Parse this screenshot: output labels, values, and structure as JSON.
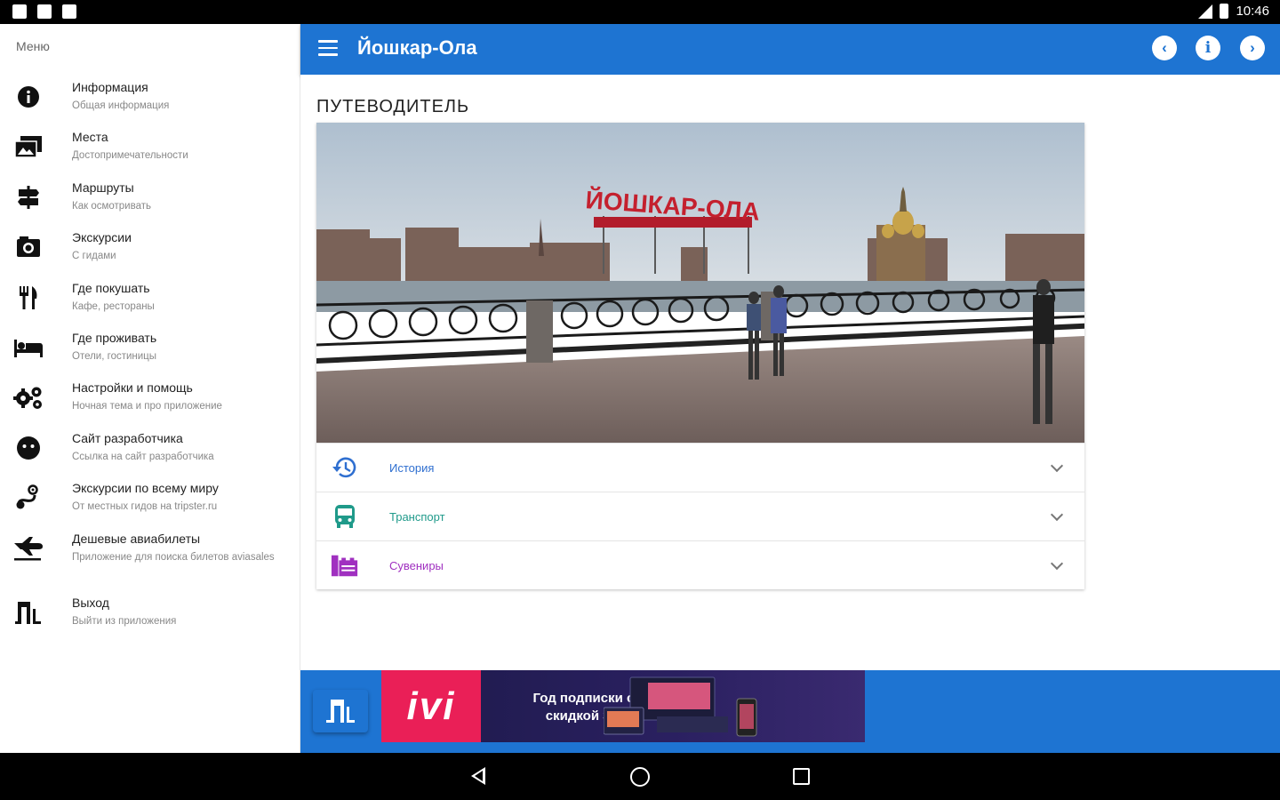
{
  "status_bar": {
    "time": "10:46"
  },
  "drawer": {
    "title": "Меню",
    "items": [
      {
        "title": "Информация",
        "subtitle": "Общая информация",
        "icon": "info-icon"
      },
      {
        "title": "Места",
        "subtitle": "Достопримечательности",
        "icon": "places-icon"
      },
      {
        "title": "Маршруты",
        "subtitle": "Как осмотривать",
        "icon": "signpost-icon"
      },
      {
        "title": "Экскурсии",
        "subtitle": "С гидами",
        "icon": "camera-icon"
      },
      {
        "title": "Где покушать",
        "subtitle": "Кафе, рестораны",
        "icon": "restaurant-icon"
      },
      {
        "title": "Где проживать",
        "subtitle": "Отели, гостиницы",
        "icon": "hotel-bed-icon"
      },
      {
        "title": "Настройки и помощь",
        "subtitle": "Ночная тема и про приложение",
        "icon": "settings-icon"
      },
      {
        "title": "Сайт разработчика",
        "subtitle": "Ссылка на сайт разработчика",
        "icon": "developer-icon"
      },
      {
        "title": "Экскурсии по всему миру",
        "subtitle": "От местных гидов на tripster.ru",
        "icon": "world-tour-icon"
      },
      {
        "title": "Дешевые авиабилеты",
        "subtitle": "Приложение для поиска билетов aviasales",
        "icon": "flight-icon"
      },
      {
        "title": "Выход",
        "subtitle": "Выйти из приложения",
        "icon": "exit-icon"
      }
    ]
  },
  "appbar": {
    "title": "Йошкар-Ола",
    "prev_symbol": "‹",
    "info_symbol": "i",
    "next_symbol": "›"
  },
  "content": {
    "section_title": "ПУТЕВОДИТЕЛЬ",
    "photo_sign": "ЙОШКАР-ОЛА",
    "accordion": [
      {
        "label": "История",
        "color": "#2f6fd0",
        "icon": "history-icon"
      },
      {
        "label": "Транспорт",
        "color": "#1f9a8a",
        "icon": "bus-icon"
      },
      {
        "label": "Сувениры",
        "color": "#a030c0",
        "icon": "souvenirs-icon"
      }
    ]
  },
  "ad": {
    "logo": "ivi",
    "text": "Год подписки со скидкой 37%"
  },
  "colors": {
    "primary": "#1e74d2",
    "ad_pink": "#ea1f57"
  }
}
